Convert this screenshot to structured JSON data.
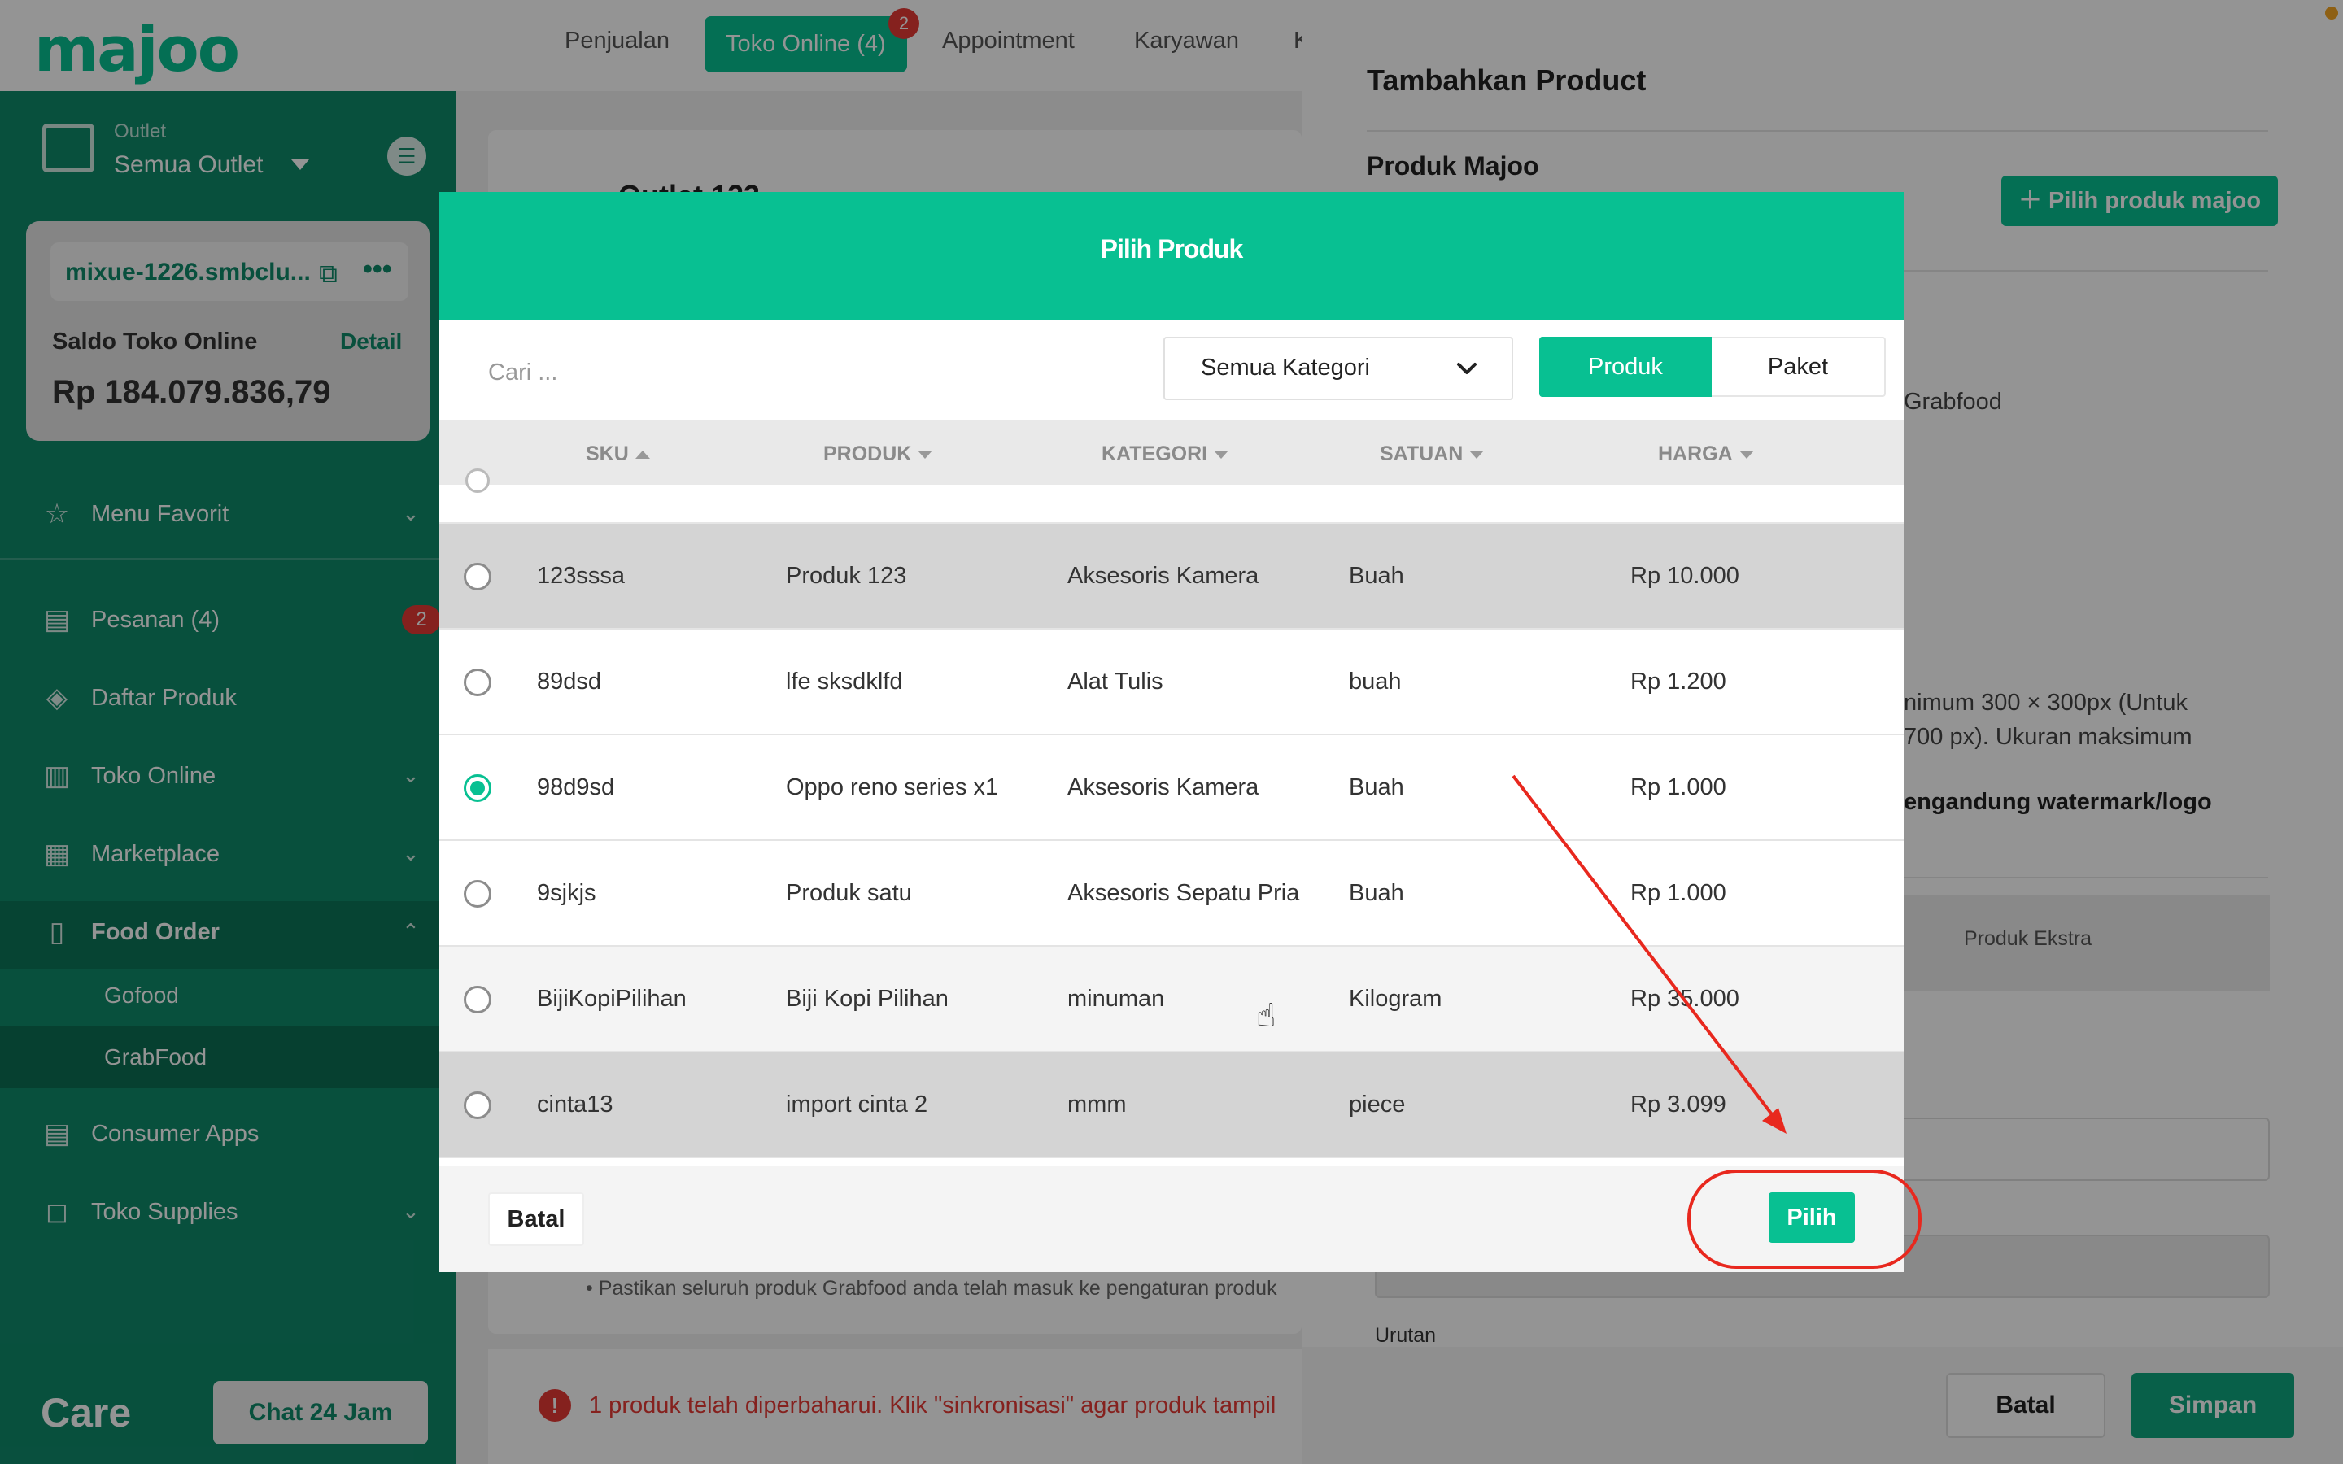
{
  "topnav": {
    "logo": "majoo",
    "items": [
      "Penjualan",
      "Toko Online (4)",
      "Appointment",
      "Karyawan",
      "K"
    ],
    "active_index": 1,
    "badge": "2"
  },
  "sidebar": {
    "outlet_label": "Outlet",
    "outlet_value": "Semua Outlet",
    "store_url": "mixue-1226.smbclu...",
    "saldo_label": "Saldo Toko Online",
    "saldo_detail": "Detail",
    "saldo_value": "Rp 184.079.836,79",
    "items": {
      "menu_favorit": "Menu Favorit",
      "pesanan": "Pesanan (4)",
      "pesanan_badge": "2",
      "daftar_produk": "Daftar Produk",
      "toko_online": "Toko Online",
      "marketplace": "Marketplace",
      "food_order": "Food Order",
      "gofood": "Gofood",
      "grabfood": "GrabFood",
      "consumer_apps": "Consumer Apps",
      "toko_supplies": "Toko Supplies"
    },
    "care": "Care",
    "chat": "Chat 24 Jam"
  },
  "main": {
    "title": "Outlet 123",
    "bullet": "• Pastikan seluruh produk Grabfood anda telah masuk ke pengaturan produk",
    "info": "1 produk telah diperbaharui. Klik \"sinkronisasi\" agar produk tampil"
  },
  "right_panel": {
    "title": "Tambahkan Product",
    "subtitle": "Produk Majoo",
    "pilih_button": "Pilih produk majoo",
    "grabfood_text": "Grabfood",
    "size_text_1": "nimum 300 × 300px (Untuk",
    "size_text_2": "700 px). Ukuran maksimum",
    "watermark_text": "engandung watermark/logo",
    "tab_extra": "Produk Ekstra",
    "urutan": "Urutan",
    "batal": "Batal",
    "simpan": "Simpan"
  },
  "modal": {
    "title": "Pilih Produk",
    "search_placeholder": "Cari ...",
    "category": "Semua Kategori",
    "segment": [
      "Produk",
      "Paket"
    ],
    "columns": [
      "SKU",
      "PRODUK",
      "KATEGORI",
      "SATUAN",
      "HARGA"
    ],
    "rows": [
      {
        "sku": "123sssa",
        "produk": "Produk 123",
        "kategori": "Aksesoris Kamera",
        "satuan": "Buah",
        "harga": "Rp 10.000",
        "selected": false
      },
      {
        "sku": "89dsd",
        "produk": "lfe sksdklfd",
        "kategori": "Alat Tulis",
        "satuan": "buah",
        "harga": "Rp 1.200",
        "selected": false
      },
      {
        "sku": "98d9sd",
        "produk": "Oppo reno series x1",
        "kategori": "Aksesoris Kamera",
        "satuan": "Buah",
        "harga": "Rp 1.000",
        "selected": true
      },
      {
        "sku": "9sjkjs",
        "produk": "Produk satu",
        "kategori": "Aksesoris Sepatu Pria",
        "satuan": "Buah",
        "harga": "Rp 1.000",
        "selected": false
      },
      {
        "sku": "BijiKopiPilihan",
        "produk": "Biji Kopi Pilihan",
        "kategori": "minuman",
        "satuan": "Kilogram",
        "harga": "Rp 35.000",
        "selected": false
      },
      {
        "sku": "cinta13",
        "produk": "import cinta 2",
        "kategori": "mmm",
        "satuan": "piece",
        "harga": "Rp 3.099",
        "selected": false
      }
    ],
    "batal": "Batal",
    "pilih": "Pilih"
  },
  "colors": {
    "brand": "#08c092",
    "sidebar": "#0f8a6a",
    "annotation": "#e8281e",
    "badge": "#e53935"
  }
}
